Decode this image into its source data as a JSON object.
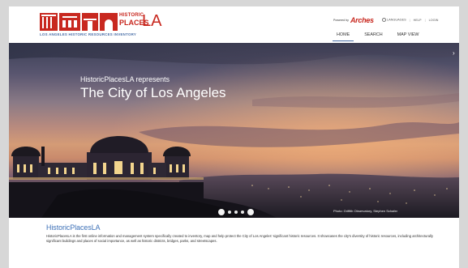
{
  "header": {
    "logo": {
      "historic": "HISTORIC",
      "places": "PLACES",
      "la": "LA",
      "subtitle": "LOS ANGELES HISTORIC RESOURCES INVENTORY"
    },
    "powered_by": "Powered by",
    "arches": "Arches",
    "top_links": [
      "LANGUAGES",
      "HELP",
      "LOGIN"
    ],
    "nav": [
      {
        "label": "HOME",
        "active": true
      },
      {
        "label": "SEARCH",
        "active": false
      },
      {
        "label": "MAP VIEW",
        "active": false
      }
    ]
  },
  "hero": {
    "subtitle": "HistoricPlacesLA represents",
    "title": "The City of Los Angeles",
    "photo_credit": "Photo: Griffith Observatory, Stephen Schafer",
    "slides": 5,
    "active_slide": 0
  },
  "intro": {
    "title": "HistoricPlacesLA",
    "text": "HistoricPlacesLA is the first online information and management system specifically created to inventory, map and help protect the City of Los Angeles' significant historic resources. It showcases the city's diversity of historic resources, including architecturally significant buildings and places of social importance, as well as historic districts, bridges, parks, and streetscapes."
  },
  "colors": {
    "brand_red": "#c8281f",
    "link_blue": "#3b6fb6",
    "nav_underline": "#4a6fa8"
  }
}
